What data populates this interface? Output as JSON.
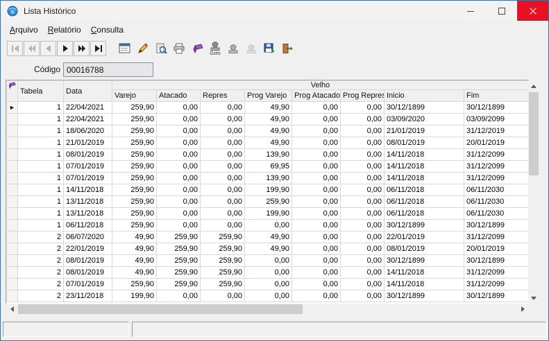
{
  "window": {
    "title": "Lista Histórico",
    "border_color": "#3a6fb0",
    "close_button_color": "#e81123"
  },
  "menu": {
    "items": [
      {
        "label": "Arquivo"
      },
      {
        "label": "Relatório"
      },
      {
        "label": "Consulta"
      }
    ]
  },
  "toolbar": {
    "goto_caption": "Goto",
    "icons": {
      "nav": [
        "first-record",
        "prior-page",
        "prior-record",
        "next-record",
        "next-page",
        "last-record"
      ],
      "tools": [
        "form-icon",
        "pencil-icon",
        "preview-icon",
        "printer-icon",
        "eraser-icon",
        "goto-stamp-icon",
        "stamp-icon",
        "stamp-disabled-icon",
        "export-disk-icon",
        "exit-door-icon"
      ]
    }
  },
  "codigo": {
    "label": "Código",
    "value": "00016788"
  },
  "grid": {
    "band_label": "Velho",
    "columns": [
      "Tabela",
      "Data",
      "Varejo",
      "Atacado",
      "Repres",
      "Prog Varejo",
      "Prog Atacado",
      "Prog Repres",
      "Inicio",
      "Fim"
    ],
    "selected_row": 0,
    "rows": [
      [
        "1",
        "22/04/2021",
        "259,90",
        "0,00",
        "0,00",
        "49,90",
        "0,00",
        "0,00",
        "30/12/1899",
        "30/12/1899"
      ],
      [
        "1",
        "22/04/2021",
        "259,90",
        "0,00",
        "0,00",
        "49,90",
        "0,00",
        "0,00",
        "03/09/2020",
        "03/09/2099"
      ],
      [
        "1",
        "18/06/2020",
        "259,90",
        "0,00",
        "0,00",
        "49,90",
        "0,00",
        "0,00",
        "21/01/2019",
        "31/12/2019"
      ],
      [
        "1",
        "21/01/2019",
        "259,90",
        "0,00",
        "0,00",
        "49,90",
        "0,00",
        "0,00",
        "08/01/2019",
        "20/01/2019"
      ],
      [
        "1",
        "08/01/2019",
        "259,90",
        "0,00",
        "0,00",
        "139,90",
        "0,00",
        "0,00",
        "14/11/2018",
        "31/12/2099"
      ],
      [
        "1",
        "07/01/2019",
        "259,90",
        "0,00",
        "0,00",
        "69,95",
        "0,00",
        "0,00",
        "14/11/2018",
        "31/12/2099"
      ],
      [
        "1",
        "07/01/2019",
        "259,90",
        "0,00",
        "0,00",
        "139,90",
        "0,00",
        "0,00",
        "14/11/2018",
        "31/12/2099"
      ],
      [
        "1",
        "14/11/2018",
        "259,90",
        "0,00",
        "0,00",
        "199,90",
        "0,00",
        "0,00",
        "06/11/2018",
        "06/11/2030"
      ],
      [
        "1",
        "13/11/2018",
        "259,90",
        "0,00",
        "0,00",
        "259,90",
        "0,00",
        "0,00",
        "06/11/2018",
        "06/11/2030"
      ],
      [
        "1",
        "13/11/2018",
        "259,90",
        "0,00",
        "0,00",
        "199,90",
        "0,00",
        "0,00",
        "06/11/2018",
        "06/11/2030"
      ],
      [
        "1",
        "06/11/2018",
        "259,90",
        "0,00",
        "0,00",
        "0,00",
        "0,00",
        "0,00",
        "30/12/1899",
        "30/12/1899"
      ],
      [
        "2",
        "06/07/2020",
        "49,90",
        "259,90",
        "259,90",
        "49,90",
        "0,00",
        "0,00",
        "22/01/2019",
        "31/12/2099"
      ],
      [
        "2",
        "22/01/2019",
        "49,90",
        "259,90",
        "259,90",
        "49,90",
        "0,00",
        "0,00",
        "08/01/2019",
        "20/01/2019"
      ],
      [
        "2",
        "08/01/2019",
        "49,90",
        "259,90",
        "259,90",
        "0,00",
        "0,00",
        "0,00",
        "30/12/1899",
        "30/12/1899"
      ],
      [
        "2",
        "08/01/2019",
        "49,90",
        "259,90",
        "259,90",
        "0,00",
        "0,00",
        "0,00",
        "14/11/2018",
        "31/12/2099"
      ],
      [
        "2",
        "07/01/2019",
        "259,90",
        "259,90",
        "259,90",
        "0,00",
        "0,00",
        "0,00",
        "14/11/2018",
        "31/12/2099"
      ],
      [
        "2",
        "23/11/2018",
        "199,90",
        "0,00",
        "0,00",
        "0,00",
        "0,00",
        "0,00",
        "30/12/1899",
        "30/12/1899"
      ]
    ]
  }
}
